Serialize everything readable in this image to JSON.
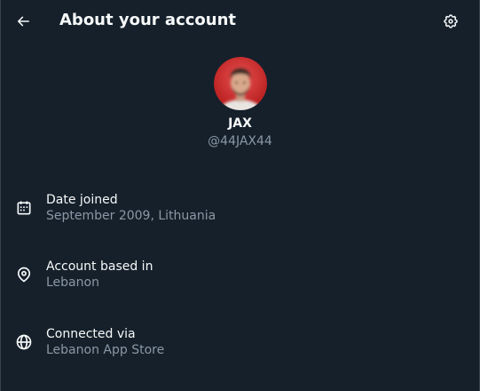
{
  "header": {
    "title": "About your account",
    "back_icon": "arrow-left-icon",
    "settings_icon": "gear-icon"
  },
  "profile": {
    "display_name": "JAX",
    "handle": "@44JAX44",
    "avatar_ring_color": "#d92d2d"
  },
  "details": [
    {
      "icon": "calendar-icon",
      "label": "Date joined",
      "value": "September 2009, Lithuania"
    },
    {
      "icon": "location-pin-icon",
      "label": "Account based in",
      "value": "Lebanon"
    },
    {
      "icon": "globe-icon",
      "label": "Connected via",
      "value": "Lebanon App Store"
    }
  ],
  "colors": {
    "background": "#15202b",
    "primary_text": "#f7f9f9",
    "secondary_text": "#8b98a5"
  }
}
